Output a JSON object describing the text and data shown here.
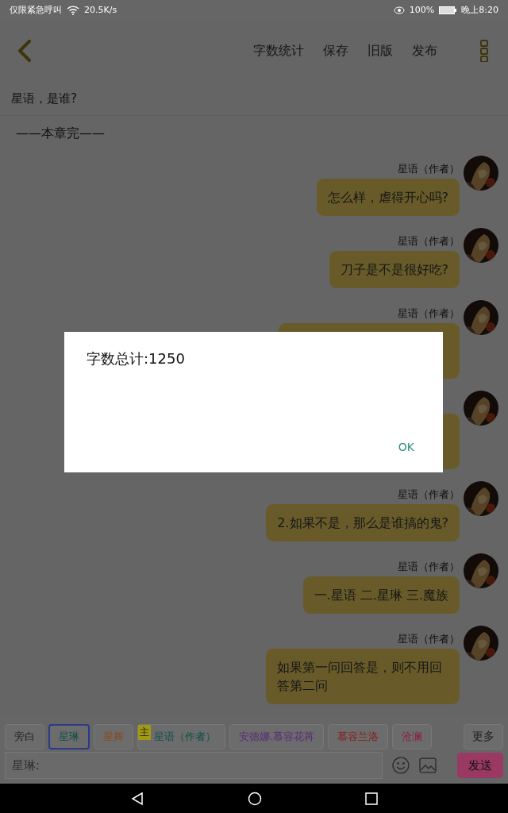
{
  "status_bar": {
    "carrier": "仅限紧急呼叫",
    "speed": "20.5K/s",
    "battery": "100%",
    "time": "晚上8:20"
  },
  "toolbar": {
    "actions": [
      "字数统计",
      "保存",
      "旧版",
      "发布"
    ]
  },
  "chapter_title": "星语，是谁?",
  "chapter_end": "——本章完——",
  "messages": [
    {
      "kind": "text",
      "name": "星语（作者）",
      "text": "怎么样，虐得开心吗?"
    },
    {
      "kind": "text",
      "name": "星语（作者）",
      "text": "刀子是不是很好吃?"
    },
    {
      "kind": "covered",
      "name": "星语（作者）"
    },
    {
      "kind": "covered"
    },
    {
      "kind": "text",
      "name": "星语（作者）",
      "text": "2.如果不是，那么是谁搞的鬼?"
    },
    {
      "kind": "text",
      "name": "星语（作者）",
      "text": "一.星语 二.星琳 三.魔族"
    },
    {
      "kind": "text",
      "name": "星语（作者）",
      "text": "如果第一问回答是，则不用回答第二问"
    }
  ],
  "characters": [
    {
      "label": "旁白",
      "color": "#1e1e1e",
      "selected": false
    },
    {
      "label": "星琳",
      "color": "#0a5048",
      "selected": true
    },
    {
      "label": "星舞",
      "color": "#8a4a1a",
      "selected": false
    },
    {
      "label": "星语（作者）",
      "color": "#0a5048",
      "selected": false,
      "badge": "主"
    },
    {
      "label": "安德娜.慕容花苒",
      "color": "#5a2a7a",
      "selected": false
    },
    {
      "label": "慕容兰洛",
      "color": "#8a1a1a",
      "selected": false
    },
    {
      "label": "沧澜",
      "color": "#8a1a4a",
      "selected": false
    }
  ],
  "more_button": "更多",
  "input": {
    "placeholder": "星琳:"
  },
  "send_button": "发送",
  "dialog": {
    "message": "字数总计:1250",
    "button": "OK"
  }
}
